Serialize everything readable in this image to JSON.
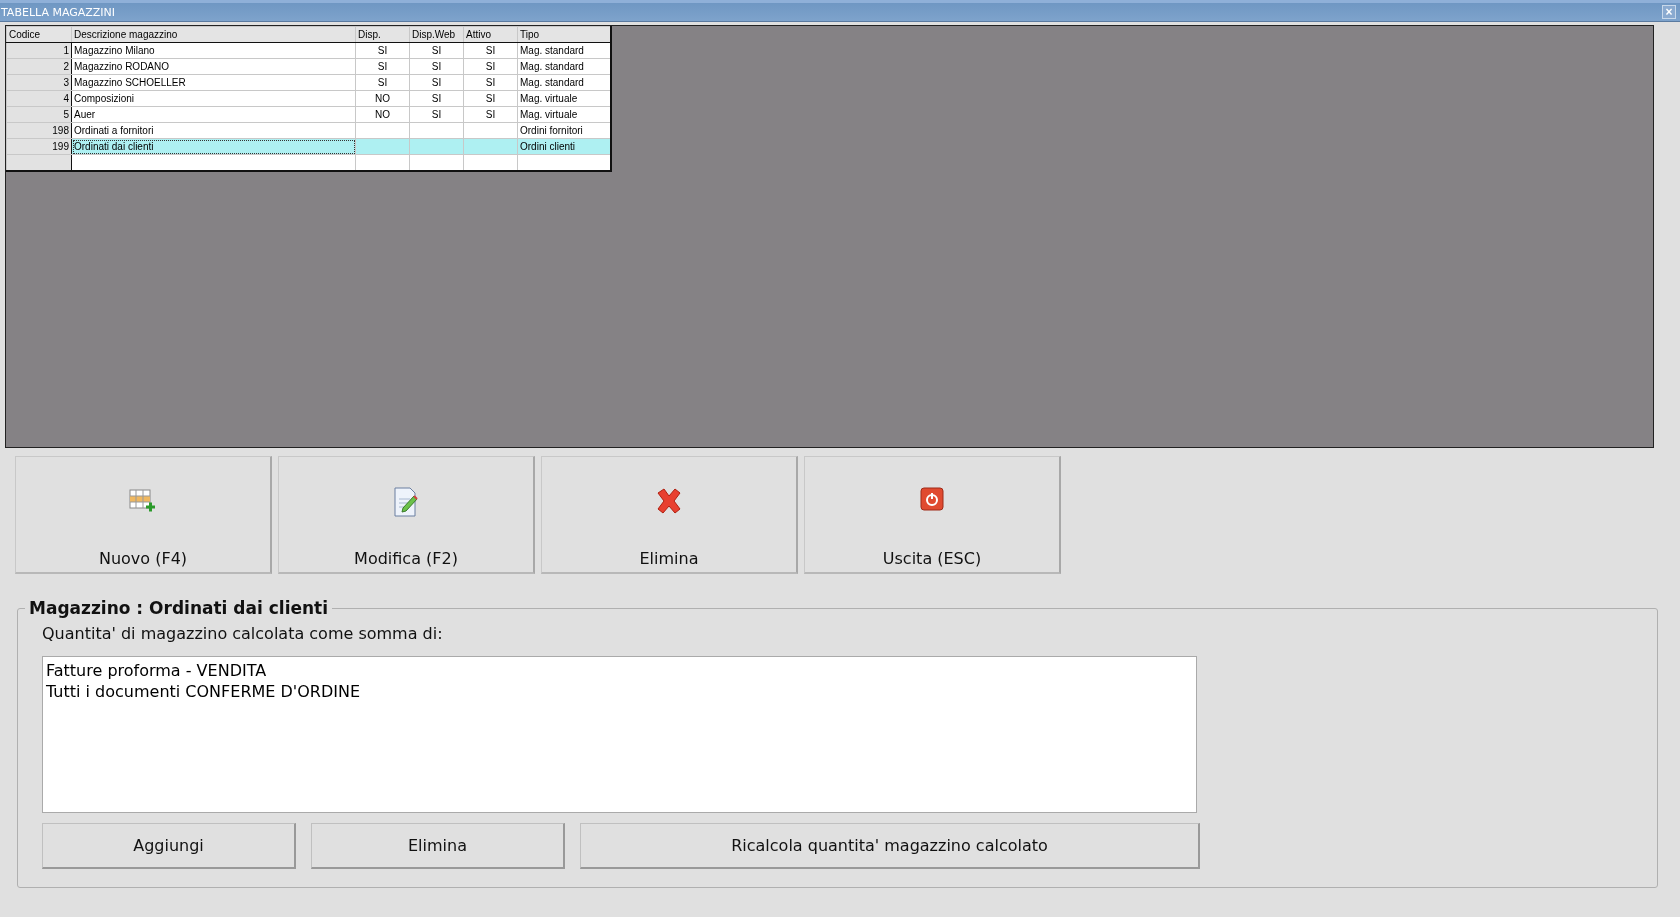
{
  "window": {
    "title": "TABELLA MAGAZZINI",
    "close": "×"
  },
  "table": {
    "columns": [
      "Codice",
      "Descrizione magazzino",
      "Disp.",
      "Disp.Web",
      "Attivo",
      "Tipo"
    ],
    "rows": [
      {
        "cells": [
          "1",
          "Magazzino Milano",
          "SI",
          "SI",
          "SI",
          "Mag. standard"
        ],
        "selected": false
      },
      {
        "cells": [
          "2",
          "Magazzino RODANO",
          "SI",
          "SI",
          "SI",
          "Mag. standard"
        ],
        "selected": false
      },
      {
        "cells": [
          "3",
          "Magazzino SCHOELLER",
          "SI",
          "SI",
          "SI",
          "Mag. standard"
        ],
        "selected": false
      },
      {
        "cells": [
          "4",
          "Composizioni",
          "NO",
          "SI",
          "SI",
          "Mag. virtuale"
        ],
        "selected": false
      },
      {
        "cells": [
          "5",
          "Auer",
          "NO",
          "SI",
          "SI",
          "Mag. virtuale"
        ],
        "selected": false
      },
      {
        "cells": [
          "198",
          "Ordinati a fornitori",
          "",
          "",
          "",
          "Ordini fornitori"
        ],
        "selected": false
      },
      {
        "cells": [
          "199",
          "Ordinati dai clienti",
          "",
          "",
          "",
          "Ordini clienti"
        ],
        "selected": true
      }
    ]
  },
  "toolbar": [
    {
      "label": "Nuovo (F4)",
      "kind": "new"
    },
    {
      "label": "Modifica (F2)",
      "kind": "edit"
    },
    {
      "label": "Elimina",
      "kind": "delete"
    },
    {
      "label": "Uscita (ESC)",
      "kind": "exit"
    }
  ],
  "detail": {
    "title": "Magazzino : Ordinati dai clienti",
    "caption": "Quantita' di magazzino calcolata come somma di:",
    "items": [
      "Fatture proforma - VENDITA",
      "Tutti i documenti CONFERME D'ORDINE"
    ],
    "buttons": [
      "Aggiungi",
      "Elimina",
      "Ricalcola quantita' magazzino calcolato"
    ]
  }
}
